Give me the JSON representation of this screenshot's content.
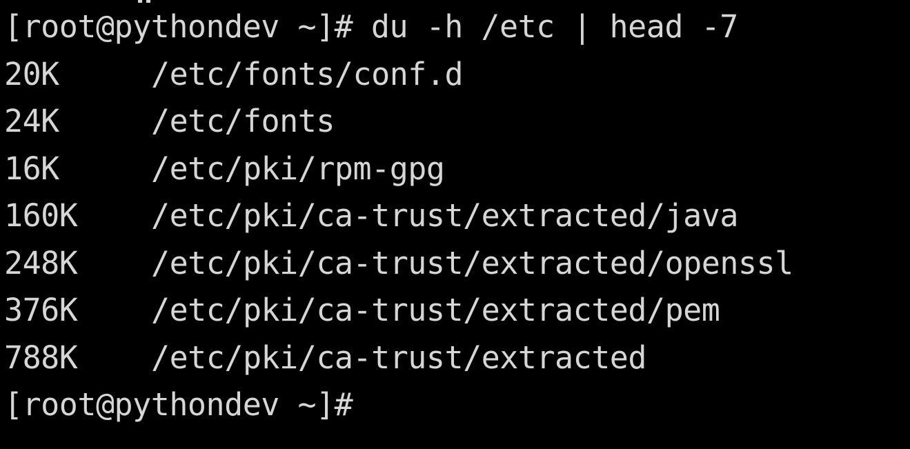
{
  "terminal": {
    "prompt_command": "[root@pythondev ~]# du -h /etc | head -7",
    "output": [
      {
        "size": "20K",
        "path": "/etc/fonts/conf.d"
      },
      {
        "size": "24K",
        "path": "/etc/fonts"
      },
      {
        "size": "16K",
        "path": "/etc/pki/rpm-gpg"
      },
      {
        "size": "160K",
        "path": "/etc/pki/ca-trust/extracted/java"
      },
      {
        "size": "248K",
        "path": "/etc/pki/ca-trust/extracted/openssl"
      },
      {
        "size": "376K",
        "path": "/etc/pki/ca-trust/extracted/pem"
      },
      {
        "size": "788K",
        "path": "/etc/pki/ca-trust/extracted"
      }
    ],
    "final_prompt": "[root@pythondev ~]#"
  },
  "colors": {
    "background": "#000000",
    "foreground": "#d6d6d6"
  }
}
